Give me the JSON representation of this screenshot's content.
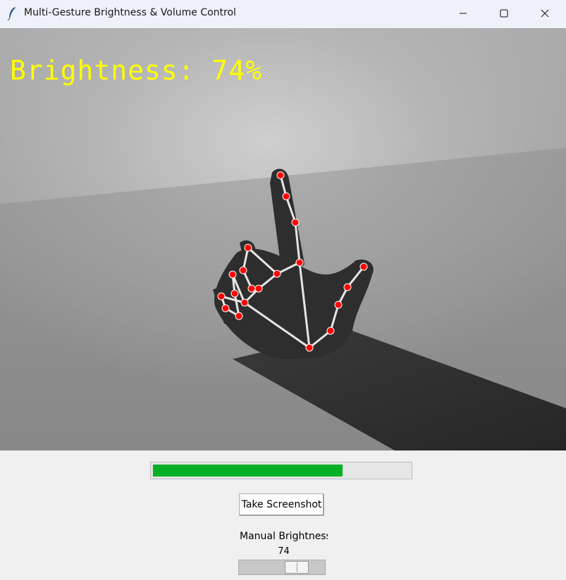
{
  "window": {
    "title": "Multi-Gesture Brightness & Volume Control",
    "app_icon": "feather-icon",
    "controls": [
      "minimize-icon",
      "maximize-icon",
      "close-icon"
    ]
  },
  "camera": {
    "overlay_text": "Brightness: 74%",
    "overlay_color": "#ffff00",
    "landmark_color": "#ff0000",
    "connection_color": "#e6e6e6"
  },
  "progress": {
    "value_percent": 74,
    "fill_color": "#06b025"
  },
  "buttons": {
    "screenshot_label": "Take Screenshot"
  },
  "scale": {
    "label": "Manual Brightness",
    "value": "74",
    "value_fraction": 0.74
  }
}
